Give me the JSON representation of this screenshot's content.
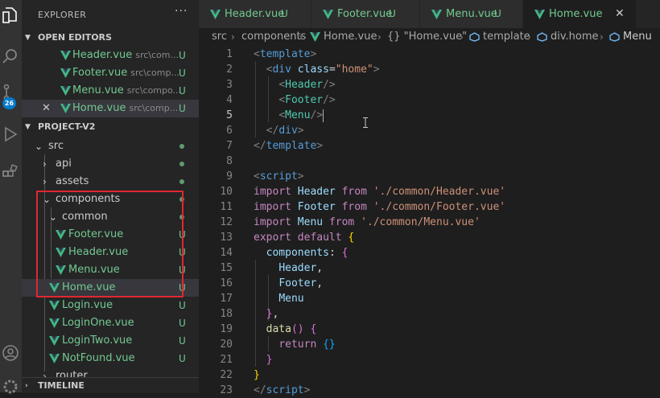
{
  "activity_bar": {
    "badge": "26"
  },
  "explorer": {
    "title": "EXPLORER",
    "more": "···",
    "open_editors": {
      "label": "OPEN EDITORS",
      "items": [
        {
          "name": "Header.vue",
          "path": "src\\com...",
          "flag": "U"
        },
        {
          "name": "Footer.vue",
          "path": "src\\comp...",
          "flag": "U"
        },
        {
          "name": "Menu.vue",
          "path": "src\\compo...",
          "flag": "U"
        },
        {
          "name": "Home.vue",
          "path": "src\\comp...",
          "flag": "U",
          "close": "✕"
        }
      ]
    },
    "project": {
      "label": "PROJECT-V2",
      "tree": [
        {
          "name": "src"
        },
        {
          "name": "api"
        },
        {
          "name": "assets"
        },
        {
          "name": "components"
        },
        {
          "name": "common"
        },
        {
          "name": "Footer.vue",
          "flag": "U"
        },
        {
          "name": "Header.vue",
          "flag": "U"
        },
        {
          "name": "Menu.vue",
          "flag": "U"
        },
        {
          "name": "Home.vue",
          "flag": "U"
        },
        {
          "name": "Login.vue",
          "flag": "U"
        },
        {
          "name": "LoginOne.vue",
          "flag": "U"
        },
        {
          "name": "LoginTwo.vue",
          "flag": "U"
        },
        {
          "name": "NotFound.vue",
          "flag": "U"
        },
        {
          "name": "router"
        }
      ]
    },
    "timeline": "TIMELINE"
  },
  "tabs": [
    {
      "name": "Header.vue",
      "flag": "U"
    },
    {
      "name": "Footer.vue",
      "flag": "U"
    },
    {
      "name": "Menu.vue",
      "flag": "U"
    },
    {
      "name": "Home.vue",
      "close": "✕"
    }
  ],
  "breadcrumb": [
    "src",
    "components",
    "Home.vue",
    "{} \"Home.vue\"",
    "template",
    "div.home",
    "Menu"
  ],
  "editor": {
    "line_numbers": [
      "1",
      "2",
      "3",
      "4",
      "5",
      "6",
      "7",
      "8",
      "9",
      "10",
      "11",
      "12",
      "13",
      "14",
      "15",
      "16",
      "17",
      "18",
      "19",
      "20",
      "21",
      "22",
      "23"
    ],
    "lines": [
      [
        [
          "tk-gray",
          "<"
        ],
        [
          "tk-tag",
          "template"
        ],
        [
          "tk-gray",
          ">"
        ]
      ],
      [
        [
          "",
          "  "
        ],
        [
          "tk-gray",
          "<"
        ],
        [
          "tk-tag",
          "div"
        ],
        [
          "",
          " "
        ],
        [
          "tk-attr",
          "class"
        ],
        [
          "",
          "="
        ],
        [
          "tk-str",
          "\"home\""
        ],
        [
          "tk-gray",
          ">"
        ]
      ],
      [
        [
          "",
          "    "
        ],
        [
          "tk-gray",
          "<"
        ],
        [
          "tk-comp",
          "Header"
        ],
        [
          "tk-gray",
          "/>"
        ]
      ],
      [
        [
          "",
          "    "
        ],
        [
          "tk-gray",
          "<"
        ],
        [
          "tk-comp",
          "Footer"
        ],
        [
          "tk-gray",
          "/>"
        ]
      ],
      [
        [
          "",
          "    "
        ],
        [
          "tk-gray",
          "<"
        ],
        [
          "tk-comp",
          "Menu"
        ],
        [
          "tk-gray",
          "/>"
        ]
      ],
      [
        [
          "",
          "  "
        ],
        [
          "tk-gray",
          "</"
        ],
        [
          "tk-tag",
          "div"
        ],
        [
          "tk-gray",
          ">"
        ]
      ],
      [
        [
          "tk-gray",
          "</"
        ],
        [
          "tk-tag",
          "template"
        ],
        [
          "tk-gray",
          ">"
        ]
      ],
      [
        [
          "",
          ""
        ]
      ],
      [
        [
          "tk-gray",
          "<"
        ],
        [
          "tk-tag",
          "script"
        ],
        [
          "tk-gray",
          ">"
        ]
      ],
      [
        [
          "tk-kw",
          "import"
        ],
        [
          "",
          " "
        ],
        [
          "tk-prop",
          "Header"
        ],
        [
          "",
          " "
        ],
        [
          "tk-kw",
          "from"
        ],
        [
          "",
          " "
        ],
        [
          "tk-str",
          "'./common/Header.vue'"
        ]
      ],
      [
        [
          "tk-kw",
          "import"
        ],
        [
          "",
          " "
        ],
        [
          "tk-prop",
          "Footer"
        ],
        [
          "",
          " "
        ],
        [
          "tk-kw",
          "from"
        ],
        [
          "",
          " "
        ],
        [
          "tk-str",
          "'./common/Footer.vue'"
        ]
      ],
      [
        [
          "tk-kw",
          "import"
        ],
        [
          "",
          " "
        ],
        [
          "tk-prop",
          "Menu"
        ],
        [
          "",
          " "
        ],
        [
          "tk-kw",
          "from"
        ],
        [
          "",
          " "
        ],
        [
          "tk-str",
          "'./common/Menu.vue'"
        ]
      ],
      [
        [
          "tk-kw",
          "export"
        ],
        [
          "",
          " "
        ],
        [
          "tk-kw",
          "default"
        ],
        [
          "",
          " "
        ],
        [
          "tk-br1",
          "{"
        ]
      ],
      [
        [
          "",
          "  "
        ],
        [
          "tk-prop",
          "components"
        ],
        [
          "",
          ": "
        ],
        [
          "tk-br2",
          "{"
        ]
      ],
      [
        [
          "",
          "    "
        ],
        [
          "tk-prop",
          "Header"
        ],
        [
          "",
          ","
        ]
      ],
      [
        [
          "",
          "    "
        ],
        [
          "tk-prop",
          "Footer"
        ],
        [
          "",
          ","
        ]
      ],
      [
        [
          "",
          "    "
        ],
        [
          "tk-prop",
          "Menu"
        ]
      ],
      [
        [
          "",
          "  "
        ],
        [
          "tk-br2",
          "}"
        ],
        [
          "",
          ","
        ]
      ],
      [
        [
          "",
          "  "
        ],
        [
          "tk-fn",
          "data"
        ],
        [
          "tk-br2",
          "()"
        ],
        [
          "",
          " "
        ],
        [
          "tk-br2",
          "{"
        ]
      ],
      [
        [
          "",
          "    "
        ],
        [
          "tk-kw",
          "return"
        ],
        [
          "",
          " "
        ],
        [
          "tk-br3",
          "{}"
        ]
      ],
      [
        [
          "",
          "  "
        ],
        [
          "tk-br2",
          "}"
        ]
      ],
      [
        [
          "tk-br1",
          "}"
        ]
      ],
      [
        [
          "tk-gray",
          "</"
        ],
        [
          "tk-tag",
          "script"
        ],
        [
          "tk-gray",
          ">"
        ]
      ]
    ]
  },
  "colors": {
    "vue": "#41b883",
    "untracked": "#73c991",
    "highlight": "#e0282e",
    "badge": "#007acc"
  }
}
